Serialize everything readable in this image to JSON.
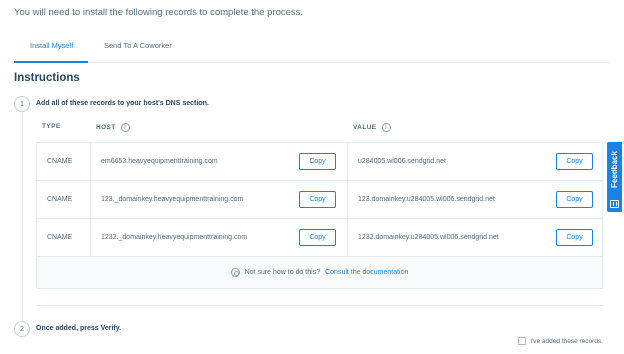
{
  "intro": "You will need to install the following records to complete the process.",
  "tabs": [
    {
      "label": "Install Myself",
      "active": true
    },
    {
      "label": "Send To A Coworker",
      "active": false
    }
  ],
  "heading": "Instructions",
  "step1": {
    "number": "1",
    "label": "Add all of these records to your host's DNS section."
  },
  "columns": {
    "type": "TYPE",
    "host": "HOST",
    "value": "VALUE"
  },
  "records": [
    {
      "type": "CNAME",
      "host": "em6653.heavyequipmenttraining.com",
      "value": "u284005.wl006.sendgrid.net",
      "copy": "Copy"
    },
    {
      "type": "CNAME",
      "host": "123._domainkey.heavyequipmenttraining.com",
      "value": "123.domainkey.u284005.wl006.sendgrid.net",
      "copy": "Copy"
    },
    {
      "type": "CNAME",
      "host": "1232._domainkey.heavyequipmenttraining.com",
      "value": "1232.domainkey.u284005.wl006.sendgrid.net",
      "copy": "Copy"
    }
  ],
  "help": {
    "text": "Not sure how to do this?",
    "link": "Consult the documentation"
  },
  "step2": {
    "number": "2",
    "label": "Once added, press Verify."
  },
  "checkbox_label": "I've added these records.",
  "feedback": "Feedback",
  "colors": {
    "accent": "#1a82e2",
    "text": "#294661",
    "muted": "#546b81",
    "border": "#e4e9ed"
  }
}
